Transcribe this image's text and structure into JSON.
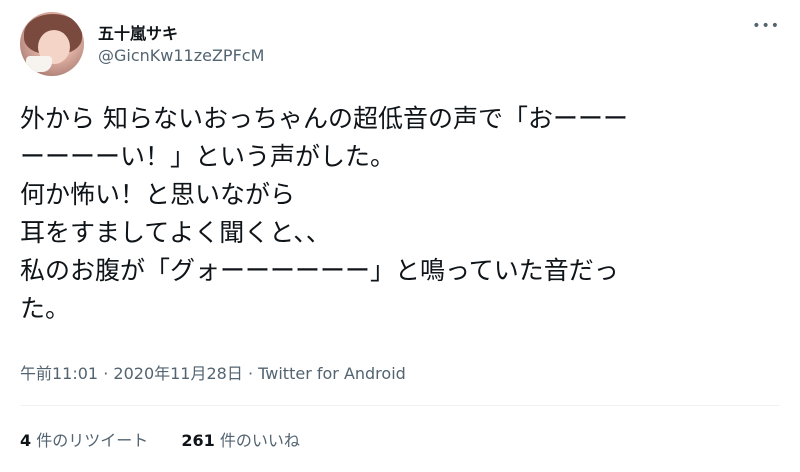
{
  "user": {
    "display_name": "五十嵐サキ",
    "handle": "@GicnKw11zeZPFcM"
  },
  "more_icon": "•••",
  "tweet": {
    "text": "外から 知らないおっちゃんの超低音の声で「おーーー\nーーーーい！」という声がした。\n何か怖い！と思いながら\n耳をすましてよく聞くと、、\n私のお腹が「グォーーーーーー」と鳴っていた音だっ\nた。"
  },
  "meta": {
    "time": "午前11:01",
    "separator": "·",
    "date": "2020年11月28日",
    "source": "Twitter for Android"
  },
  "stats": {
    "retweets_count": "4",
    "retweets_label": "件のリツイート",
    "likes_count": "261",
    "likes_label": "件のいいね"
  }
}
